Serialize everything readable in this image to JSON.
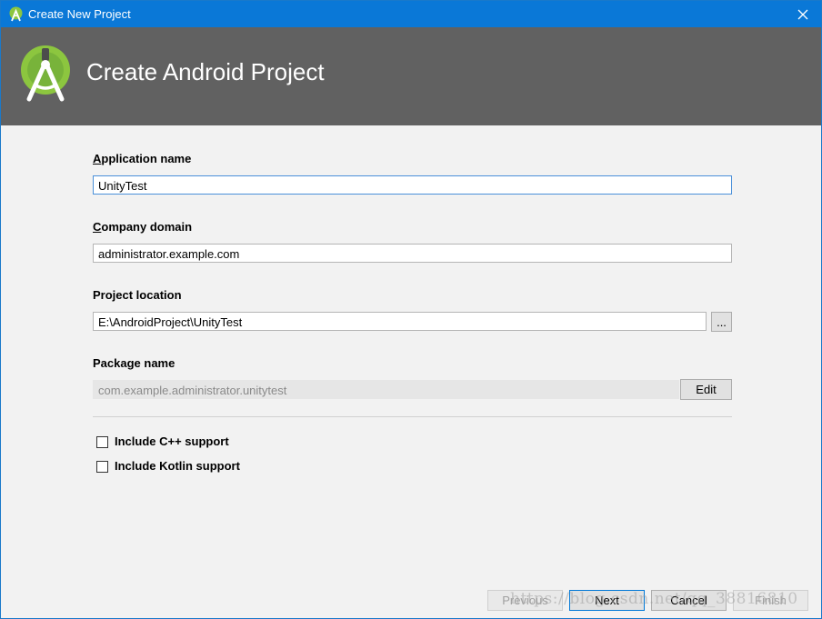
{
  "window": {
    "title": "Create New Project",
    "close_glyph": "✕"
  },
  "banner": {
    "heading": "Create Android Project",
    "logo_icon": "android-studio-logo-icon"
  },
  "form": {
    "app_name": {
      "label_mnemonic": "A",
      "label_rest": "pplication name",
      "value": "UnityTest"
    },
    "company_domain": {
      "label_mnemonic": "C",
      "label_rest": "ompany domain",
      "value": "administrator.example.com"
    },
    "project_location": {
      "label": "Project location",
      "value": "E:\\AndroidProject\\UnityTest",
      "browse_label": "..."
    },
    "package_name": {
      "label": "Package name",
      "value": "com.example.administrator.unitytest",
      "edit_label": "Edit"
    },
    "checkboxes": [
      {
        "label": "Include C++ support",
        "checked": false
      },
      {
        "label": "Include Kotlin support",
        "checked": false
      }
    ]
  },
  "footer": {
    "previous_label": "Previous",
    "next_label": "Next",
    "cancel_label": "Cancel",
    "finish_label": "Finish"
  },
  "watermark": "https://blog.csdn.net/qq_38816810",
  "colors": {
    "titlebar": "#0a78d7",
    "banner": "#616161",
    "android_green": "#8cc63f"
  }
}
